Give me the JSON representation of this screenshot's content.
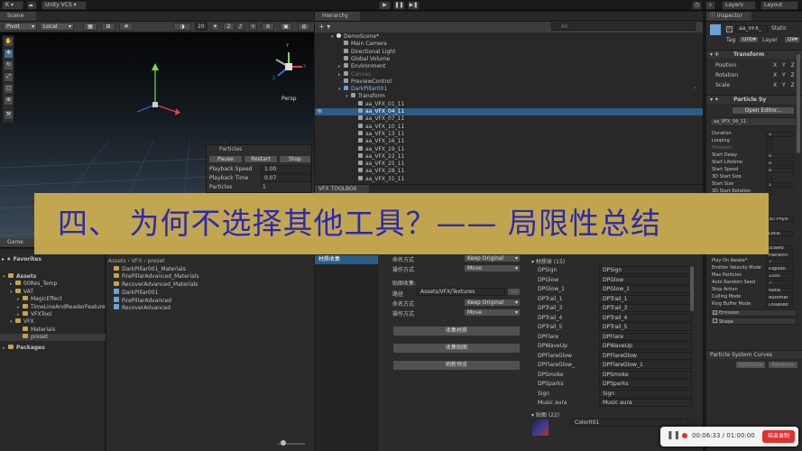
{
  "topbar": {
    "account": "K ▾",
    "vcs": "Unity VCS ▾",
    "layers": "Layers",
    "layout": "Layout"
  },
  "scene": {
    "tab": "Scene",
    "pivot": "Pivot",
    "local": "Local",
    "grid_size": "20",
    "persp": "Persp",
    "axis_y": "Y",
    "axis_x": "X",
    "axis_z": "Z"
  },
  "particles_overlay": {
    "title": "Particles",
    "buttons": [
      "Pause",
      "Restart",
      "Stop"
    ],
    "rows": [
      {
        "label": "Playback Speed",
        "value": "1.00"
      },
      {
        "label": "Playback Time",
        "value": "0.07"
      },
      {
        "label": "Particles",
        "value": "1"
      }
    ]
  },
  "hierarchy": {
    "tab": "Hierarchy",
    "search_placeholder": "All",
    "rows": [
      {
        "label": "DemoScene*",
        "indent": 0,
        "fold": "▾",
        "icon": "scene"
      },
      {
        "label": "Main Camera",
        "indent": 1,
        "fold": "",
        "icon": "cube"
      },
      {
        "label": "Directional Light",
        "indent": 1,
        "fold": "",
        "icon": "cube"
      },
      {
        "label": "Global Volume",
        "indent": 1,
        "fold": "",
        "icon": "cube"
      },
      {
        "label": "Environment",
        "indent": 1,
        "fold": "▸",
        "icon": "cube"
      },
      {
        "label": "Canvas",
        "indent": 1,
        "fold": "▸",
        "icon": "cube",
        "dim": true
      },
      {
        "label": "PreviewControl",
        "indent": 1,
        "fold": "",
        "icon": "cube"
      },
      {
        "label": "DarkPillar001",
        "indent": 1,
        "fold": "▾",
        "icon": "cube",
        "blue": true
      },
      {
        "label": "Transform",
        "indent": 2,
        "fold": "▾",
        "icon": "cube"
      },
      {
        "label": "aa_VFX_01_11",
        "indent": 3,
        "fold": "",
        "icon": "cube"
      },
      {
        "label": "aa_VFX_04_11",
        "indent": 3,
        "fold": "",
        "icon": "cube",
        "selected": true
      },
      {
        "label": "aa_VFX_07_11",
        "indent": 3,
        "fold": "",
        "icon": "cube"
      },
      {
        "label": "aa_VFX_10_11",
        "indent": 3,
        "fold": "",
        "icon": "cube"
      },
      {
        "label": "aa_VFX_13_11",
        "indent": 3,
        "fold": "",
        "icon": "cube"
      },
      {
        "label": "aa_VFX_16_11",
        "indent": 3,
        "fold": "",
        "icon": "cube"
      },
      {
        "label": "aa_VFX_19_11",
        "indent": 3,
        "fold": "",
        "icon": "cube"
      },
      {
        "label": "aa_VFX_22_11",
        "indent": 3,
        "fold": "",
        "icon": "cube"
      },
      {
        "label": "aa_VFX_25_11",
        "indent": 3,
        "fold": "",
        "icon": "cube"
      },
      {
        "label": "aa_VFX_28_11",
        "indent": 3,
        "fold": "",
        "icon": "cube"
      },
      {
        "label": "aa_VFX_31_11",
        "indent": 3,
        "fold": "",
        "icon": "cube"
      }
    ]
  },
  "inspector": {
    "tab": "Inspector",
    "object_name": "aa_VFX_",
    "static_label": "Static",
    "tag_label": "Tag",
    "tag_value": "Untı",
    "layer_label": "Layer",
    "layer_value": "De",
    "transform_title": "Transform",
    "transform_rows": [
      {
        "label": "Position",
        "axes": "X Y Z"
      },
      {
        "label": "Rotation",
        "axes": "X Y Z"
      },
      {
        "label": "Scale",
        "axes": "X Y Z"
      }
    ],
    "particle_title": "Particle Sy",
    "open_editor": "Open Editor...",
    "system_name": "aa_VFX_04_11",
    "props": [
      {
        "label": "Duration",
        "value": "1"
      },
      {
        "label": "Looping",
        "value": ""
      },
      {
        "label": "Prewarm",
        "value": "",
        "dim": true
      },
      {
        "label": "Start Delay",
        "value": "0"
      },
      {
        "label": "Start Lifetime",
        "value": "0"
      },
      {
        "label": "Start Speed",
        "value": "0"
      },
      {
        "label": "3D Start Size",
        "value": ""
      },
      {
        "label": "Start Size",
        "value": "1"
      },
      {
        "label": "3D Start Rotation",
        "value": ""
      }
    ],
    "lower_props": [
      {
        "label": "Play On Awake*",
        "value": "✓"
      },
      {
        "label": "Emitter Velocity Mode",
        "value": "Rigidbo"
      },
      {
        "label": "Max Particles",
        "value": "1000"
      },
      {
        "label": "Auto Random Seed",
        "value": "✓"
      },
      {
        "label": "Stop Action",
        "value": "None"
      },
      {
        "label": "Culling Mode",
        "value": "Automat"
      },
      {
        "label": "Ring Buffer Mode",
        "value": "Disabled"
      }
    ],
    "partial_values": [
      "3D Physi",
      "Local",
      "Scaled",
      "Hierarch"
    ],
    "modules": [
      "Emission",
      "Shape"
    ],
    "curves_title": "Particle System Curves",
    "optimize": "Optimize",
    "remove": "Remove"
  },
  "vfx_toolbox": {
    "tab": "VFX TOOLBOX",
    "naming_label": "命名方式",
    "naming_value": "Keep Original",
    "op_label": "操作方式",
    "op_value": "Move",
    "texture_section": "贴图收集:",
    "path_label": "路径",
    "path_value": "Assets/VFX/Textures",
    "browse": "...",
    "tex_naming_label": "命名方式",
    "tex_naming_value": "Keep Original",
    "tex_op_label": "操作方式",
    "tex_op_value": "Move",
    "collect_materials": "收集材质",
    "collect_textures": "收集贴图",
    "refresh_preview": "刷新预览",
    "left_tab": "材质收集"
  },
  "materials": {
    "header": "材质球 (15)",
    "rows": [
      {
        "name": "DPSign",
        "value": "DPSign"
      },
      {
        "name": "DPGlow",
        "value": "DPGlow"
      },
      {
        "name": "DPGlow_1",
        "value": "DPGlow_1"
      },
      {
        "name": "DPTrail_1",
        "value": "DPTrail_1"
      },
      {
        "name": "DPTrail_3",
        "value": "DPTrail_3"
      },
      {
        "name": "DPTrail_4",
        "value": "DPTrail_4"
      },
      {
        "name": "DPTrail_5",
        "value": "DPTrail_5"
      },
      {
        "name": "DPFlare",
        "value": "DPFlare"
      },
      {
        "name": "DPWaveUp",
        "value": "DPWaveUp"
      },
      {
        "name": "DPFlareGlow",
        "value": "DPFlareGlow"
      },
      {
        "name": "DPFlareGlow_",
        "value": "DPFlareGlow_1"
      },
      {
        "name": "DPSmoke",
        "value": "DPSmoke"
      },
      {
        "name": "DPSparks",
        "value": "DPSparks"
      },
      {
        "name": "Sign",
        "value": "Sign"
      },
      {
        "name": "Music aura",
        "value": "Music aura"
      }
    ],
    "textures_header": "贴图 (22)",
    "texture_first": "Color001"
  },
  "project": {
    "tab": "Game",
    "breadcrumb": "Assets › VFX › preset",
    "favorites": "Favorites",
    "tree": [
      {
        "label": "Assets",
        "indent": 0,
        "fold": "▾",
        "bold": true
      },
      {
        "label": "00Res_Temp",
        "indent": 1,
        "fold": "▸"
      },
      {
        "label": "VAT",
        "indent": 1,
        "fold": "▾"
      },
      {
        "label": "MagicEffect",
        "indent": 2,
        "fold": "▸"
      },
      {
        "label": "TimeLineAndReaderFeature",
        "indent": 2,
        "fold": "▸"
      },
      {
        "label": "VFXTool",
        "indent": 2,
        "fold": "▸"
      },
      {
        "label": "VFX",
        "indent": 1,
        "fold": "▾"
      },
      {
        "label": "Materials",
        "indent": 2,
        "fold": ""
      },
      {
        "label": "preset",
        "indent": 2,
        "fold": "",
        "selected": true
      },
      {
        "label": "Packages",
        "indent": 0,
        "fold": "▸",
        "bold": true
      }
    ],
    "files": [
      {
        "label": "DarkPillar001_Materials",
        "icon": "folder"
      },
      {
        "label": "FirePillarAdvanced_Materials",
        "icon": "folder"
      },
      {
        "label": "RecoverAdvanced_Materials",
        "icon": "folder"
      },
      {
        "label": "DarkPillar001",
        "icon": "prefab"
      },
      {
        "label": "FirePillarAdvanced",
        "icon": "prefab"
      },
      {
        "label": "RecoverAdvanced",
        "icon": "prefab"
      }
    ]
  },
  "banner": {
    "text": "四、 为何不选择其他工具？—— 局限性总结"
  },
  "recorder": {
    "time": "00:06:33 / 01:00:00",
    "stop_label": "结束录制"
  },
  "colors": {
    "accent": "#2c5d87",
    "banner_bg": "#c8aa50",
    "banner_text": "#2a2ab6",
    "record_red": "#e03030"
  }
}
